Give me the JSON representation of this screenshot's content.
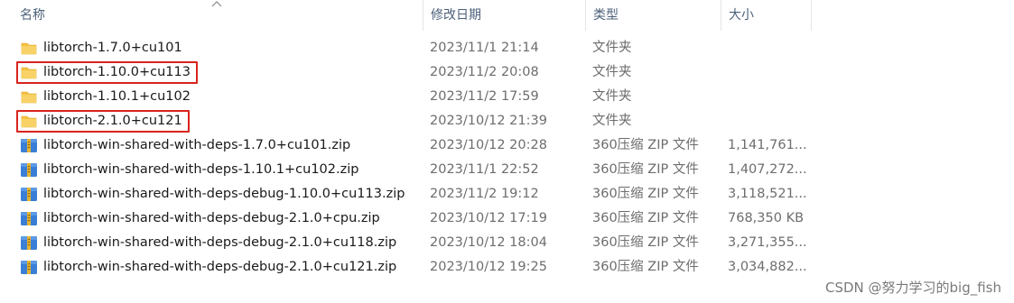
{
  "columns": {
    "name": "名称",
    "date": "修改日期",
    "type": "类型",
    "size": "大小"
  },
  "sort": {
    "column": "name",
    "direction": "ascending",
    "icon": "sort-up-icon"
  },
  "files": [
    {
      "name": "libtorch-1.7.0+cu101",
      "date": "2023/11/1 21:14",
      "type": "文件夹",
      "size": "",
      "icon": "folder-icon",
      "highlighted": false
    },
    {
      "name": "libtorch-1.10.0+cu113",
      "date": "2023/11/2 20:08",
      "type": "文件夹",
      "size": "",
      "icon": "folder-icon",
      "highlighted": true
    },
    {
      "name": "libtorch-1.10.1+cu102",
      "date": "2023/11/2 17:59",
      "type": "文件夹",
      "size": "",
      "icon": "folder-icon",
      "highlighted": false
    },
    {
      "name": "libtorch-2.1.0+cu121",
      "date": "2023/10/12 21:39",
      "type": "文件夹",
      "size": "",
      "icon": "folder-icon",
      "highlighted": true
    },
    {
      "name": "libtorch-win-shared-with-deps-1.7.0+cu101.zip",
      "date": "2023/10/12 20:28",
      "type": "360压缩 ZIP 文件",
      "size": "1,141,761...",
      "icon": "zip-archive-icon",
      "highlighted": false
    },
    {
      "name": "libtorch-win-shared-with-deps-1.10.1+cu102.zip",
      "date": "2023/11/1 22:52",
      "type": "360压缩 ZIP 文件",
      "size": "1,407,272...",
      "icon": "zip-archive-icon",
      "highlighted": false
    },
    {
      "name": "libtorch-win-shared-with-deps-debug-1.10.0+cu113.zip",
      "date": "2023/11/2 19:12",
      "type": "360压缩 ZIP 文件",
      "size": "3,118,521...",
      "icon": "zip-archive-icon",
      "highlighted": false
    },
    {
      "name": "libtorch-win-shared-with-deps-debug-2.1.0+cpu.zip",
      "date": "2023/10/12 17:19",
      "type": "360压缩 ZIP 文件",
      "size": "768,350 KB",
      "icon": "zip-archive-icon",
      "highlighted": false
    },
    {
      "name": "libtorch-win-shared-with-deps-debug-2.1.0+cu118.zip",
      "date": "2023/10/12 18:04",
      "type": "360压缩 ZIP 文件",
      "size": "3,271,355...",
      "icon": "zip-archive-icon",
      "highlighted": false
    },
    {
      "name": "libtorch-win-shared-with-deps-debug-2.1.0+cu121.zip",
      "date": "2023/10/12 19:25",
      "type": "360压缩 ZIP 文件",
      "size": "3,034,882...",
      "icon": "zip-archive-icon",
      "highlighted": false
    }
  ],
  "colors": {
    "highlight_border": "#d9231d",
    "folder": "#f5c342",
    "zip_blue": "#3a7fd5",
    "zip_gold": "#e8b530"
  },
  "watermark": "CSDN @努力学习的big_fish"
}
